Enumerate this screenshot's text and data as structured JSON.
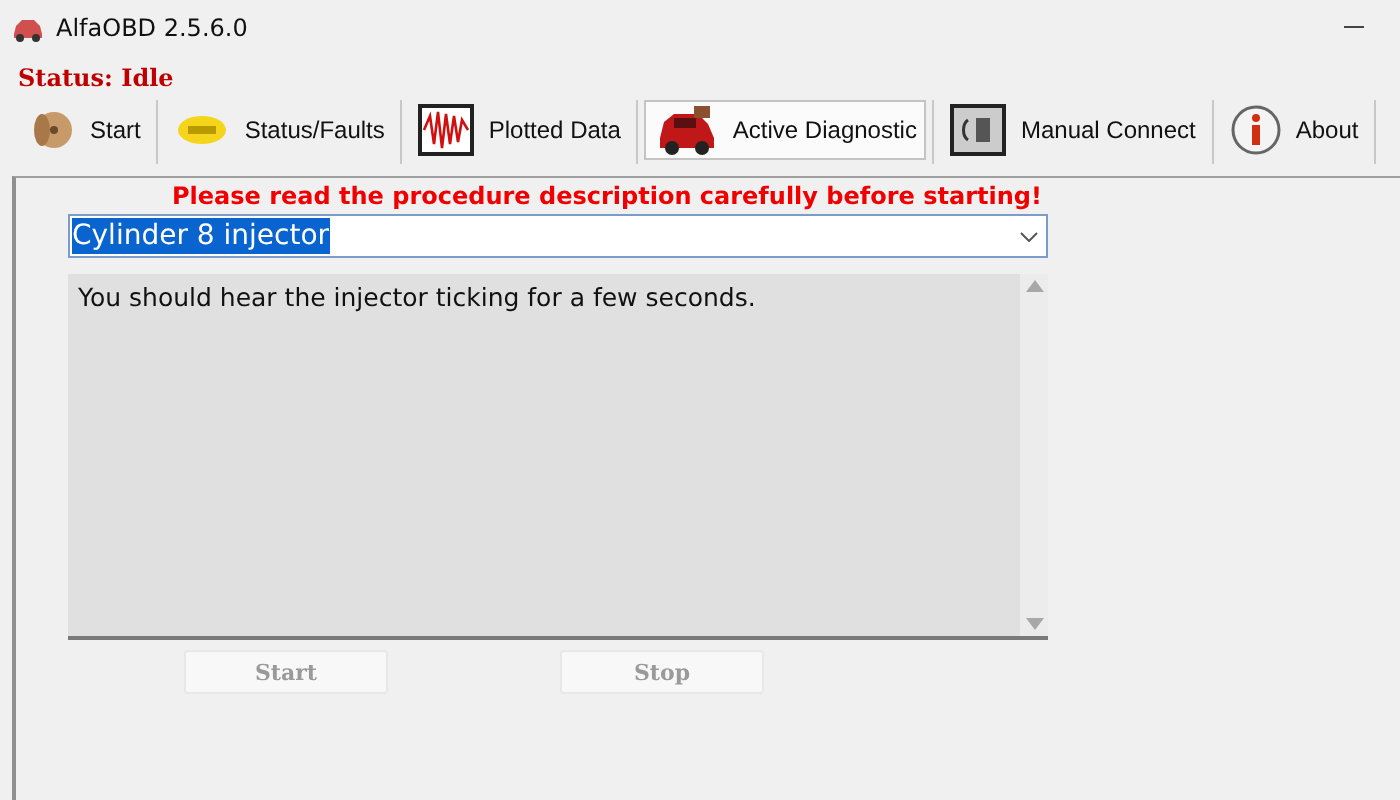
{
  "window": {
    "title": "AlfaOBD 2.5.6.0"
  },
  "status": "Status: Idle",
  "toolbar": [
    {
      "label": "Start",
      "selected": false
    },
    {
      "label": "Status/Faults",
      "selected": false
    },
    {
      "label": "Plotted Data",
      "selected": false
    },
    {
      "label": "Active Diagnostic",
      "selected": true
    },
    {
      "label": "Manual Connect",
      "selected": false
    },
    {
      "label": "About",
      "selected": false
    }
  ],
  "warning": "Please read the procedure description carefully before starting!",
  "procedure": {
    "value": "Cylinder 8 injector"
  },
  "description": "You should hear the injector ticking for a few seconds.",
  "buttons": [
    {
      "label": "Start",
      "disabled": true
    },
    {
      "label": "Stop",
      "disabled": true
    }
  ]
}
